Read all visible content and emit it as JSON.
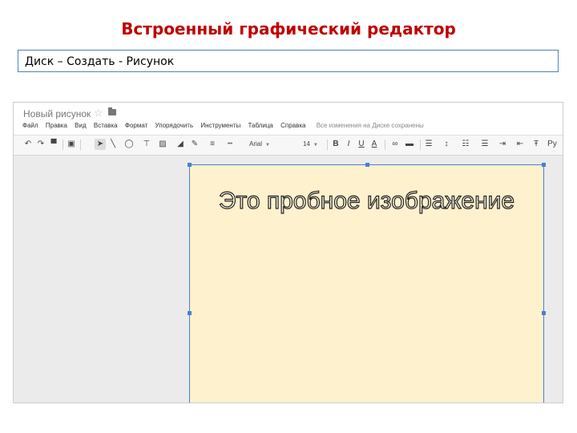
{
  "slide": {
    "title": "Встроенный графический редактор",
    "path": "Диск – Создать - Рисунок"
  },
  "app": {
    "doc_title": "Новый рисунок",
    "menu": [
      "Файл",
      "Правка",
      "Вид",
      "Вставка",
      "Формат",
      "Упорядочить",
      "Инструменты",
      "Таблица",
      "Справка"
    ],
    "save_status": "Все изменения на Диске сохранены",
    "toolbar": {
      "font": "Arial",
      "font_size": "14",
      "text_color_label": "A",
      "icons": [
        "undo-icon",
        "redo-icon",
        "paint-format-icon",
        "zoom-icon",
        "select-icon",
        "line-icon",
        "shape-icon",
        "textbox-icon",
        "image-icon",
        "fill-color-icon",
        "line-color-icon",
        "line-weight-icon",
        "line-dash-icon",
        "bold-icon",
        "italic-icon",
        "underline-icon",
        "text-color-icon",
        "link-icon",
        "comment-icon",
        "align-icon",
        "line-spacing-icon",
        "numbered-list-icon",
        "bulleted-list-icon",
        "indent-icon",
        "clear-format-icon",
        "input-tools-icon"
      ]
    },
    "canvas_text": "Это пробное изображение"
  }
}
